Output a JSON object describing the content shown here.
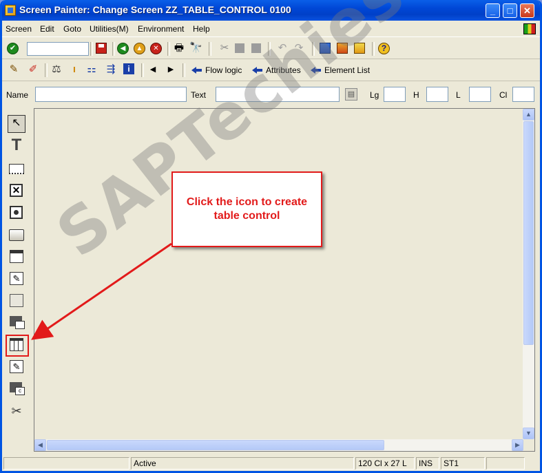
{
  "window": {
    "title": "Screen Painter:  Change Screen ZZ_TABLE_CONTROL 0100",
    "minimize": "_",
    "maximize": "□",
    "close": "✕"
  },
  "menubar": {
    "items": [
      {
        "label": "Screen"
      },
      {
        "label": "Edit"
      },
      {
        "label": "Goto"
      },
      {
        "label": "Utilities(M)"
      },
      {
        "label": "Environment"
      },
      {
        "label": "Help"
      }
    ]
  },
  "toolbar2": {
    "flow_logic": "Flow logic",
    "attributes": "Attributes",
    "element_list": "Element List"
  },
  "fields": {
    "name_label": "Name",
    "name_value": "",
    "text_label": "Text",
    "text_value": "",
    "lg_label": "Lg",
    "h_label": "H",
    "l_label": "L",
    "cl_label": "Cl"
  },
  "callout": {
    "line1": "Click the icon to create",
    "line2": "table control"
  },
  "watermark": "SAPTechies.com",
  "statusbar": {
    "status": "Active",
    "size": "120 Cl x 27 L",
    "mode": "INS",
    "system": "ST1"
  },
  "colors": {
    "accent_red": "#e21a1a",
    "title_blue": "#0047d6"
  }
}
